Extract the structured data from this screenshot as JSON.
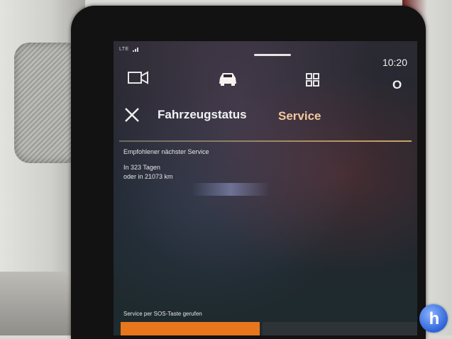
{
  "status_bar": {
    "network": "LTE",
    "time": "10:20"
  },
  "top_nav": {
    "icons": [
      "camera-icon",
      "car-icon",
      "apps-grid-icon",
      "profile-icon"
    ],
    "profile_letter": "O"
  },
  "header": {
    "title": "Fahrzeugstatus",
    "active_tab": "Service"
  },
  "service_info": {
    "headline": "Empfohlener nächster Service",
    "days": "In 323 Tagen",
    "km": "oder in 21073 km"
  },
  "footer": {
    "sos_note": "Service per SOS-Taste gerufen"
  },
  "colors": {
    "accent_orange": "#e8761c",
    "tab_active": "#f4c9a0",
    "divider_gold": "#c9a46a"
  }
}
